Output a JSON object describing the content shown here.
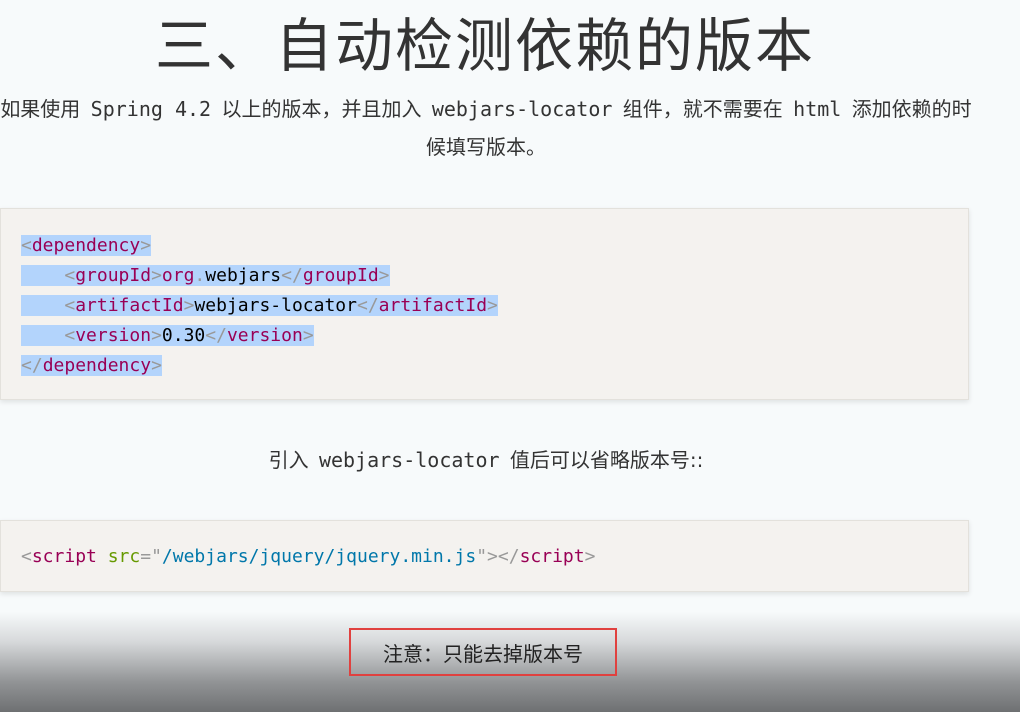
{
  "title": "三、自动检测依赖的版本",
  "intro": {
    "part1": "如果使用",
    "code1": "Spring 4.2",
    "part2": "以上的版本，并且加入",
    "code2": "webjars-locator",
    "part3": "组件，就不需要在",
    "code3": "html",
    "part4": "添加依赖的时候填写版本。"
  },
  "xml_block": {
    "line1": {
      "open": "<",
      "tag": "dependency",
      "close": ">"
    },
    "line2": {
      "indent": "    ",
      "open": "<",
      "tag": "groupId",
      "close": ">",
      "text_a": "org",
      "dot": ".",
      "text_b": "webjars",
      "end_open": "</",
      "end_tag": "groupId",
      "end_close": ">"
    },
    "line3": {
      "indent": "    ",
      "open": "<",
      "tag": "artifactId",
      "close": ">",
      "text": "webjars-locator",
      "end_open": "</",
      "end_tag": "artifactId",
      "end_close": ">"
    },
    "line4": {
      "indent": "    ",
      "open": "<",
      "tag": "version",
      "close": ">",
      "text": "0.30",
      "end_open": "</",
      "end_tag": "version",
      "end_close": ">"
    },
    "line5": {
      "open": "</",
      "tag": "dependency",
      "close": ">"
    }
  },
  "sentence": {
    "part1": "引入",
    "code": "webjars-locator",
    "part2": "值后可以省略版本号::"
  },
  "script_block": {
    "open": "<",
    "tag": "script",
    "attr": "src",
    "eq": "=",
    "quote_open": "\"",
    "value": "/webjars/jquery/jquery.min.js",
    "quote_close": "\"",
    "gt": ">",
    "end_open": "</",
    "end_tag": "script",
    "end_close": ">"
  },
  "note": "注意：只能去掉版本号",
  "colors": {
    "tag": "#990055",
    "punctuation": "#999999",
    "attr_name": "#669900",
    "attr_value": "#0077aa",
    "selection": "#b3d4fc",
    "note_border": "#e0413f"
  }
}
